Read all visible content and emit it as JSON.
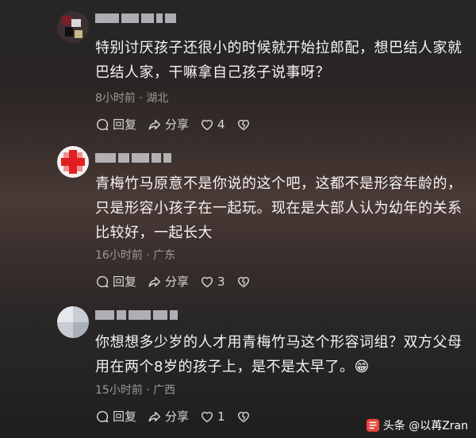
{
  "comments": [
    {
      "text": "特别讨厌孩子还很小的时候就开始拉郎配，想巴结人家就巴结人家，干嘛拿自己孩子说事呀？",
      "meta": "8小时前 · 湖北",
      "reply_label": "回复",
      "share_label": "分享",
      "likes": "4"
    },
    {
      "text": "青梅竹马原意不是你说的这个吧，这都不是形容年龄的，只是形容小孩子在一起玩。现在是大部人认为幼年的关系比较好，一起长大",
      "meta": "16小时前 · 广东",
      "reply_label": "回复",
      "share_label": "分享",
      "likes": "3"
    },
    {
      "text": "你想想多少岁的人才用青梅竹马这个形容词组？双方父母用在两个8岁的孩子上，是不是太早了。😁",
      "meta": "15小时前 · 广西",
      "reply_label": "回复",
      "share_label": "分享",
      "likes": "1"
    }
  ],
  "footer": {
    "brand": "头条 @以苒Zran"
  },
  "icons": [
    "reply-icon",
    "share-icon",
    "like-icon",
    "dislike-icon"
  ]
}
